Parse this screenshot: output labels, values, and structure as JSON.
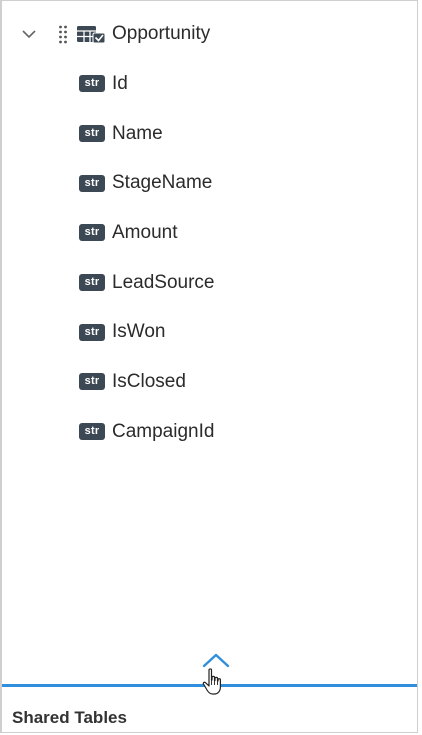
{
  "table": {
    "name": "Opportunity",
    "expand_icon": "chevron-down-icon",
    "drag_icon": "drag-handle-icon",
    "table_icon": "table-icon"
  },
  "fields": [
    {
      "type": "str",
      "name": "Id"
    },
    {
      "type": "str",
      "name": "Name"
    },
    {
      "type": "str",
      "name": "StageName"
    },
    {
      "type": "str",
      "name": "Amount"
    },
    {
      "type": "str",
      "name": "LeadSource"
    },
    {
      "type": "str",
      "name": "IsWon"
    },
    {
      "type": "str",
      "name": "IsClosed"
    },
    {
      "type": "str",
      "name": "CampaignId"
    }
  ],
  "splitter": {
    "toggle_icon": "chevron-up-icon",
    "accent_color": "#2f8fdd"
  },
  "shared_section": {
    "title": "Shared Tables"
  },
  "colors": {
    "badge_bg": "#3c4854",
    "text": "#2b2b2b"
  }
}
